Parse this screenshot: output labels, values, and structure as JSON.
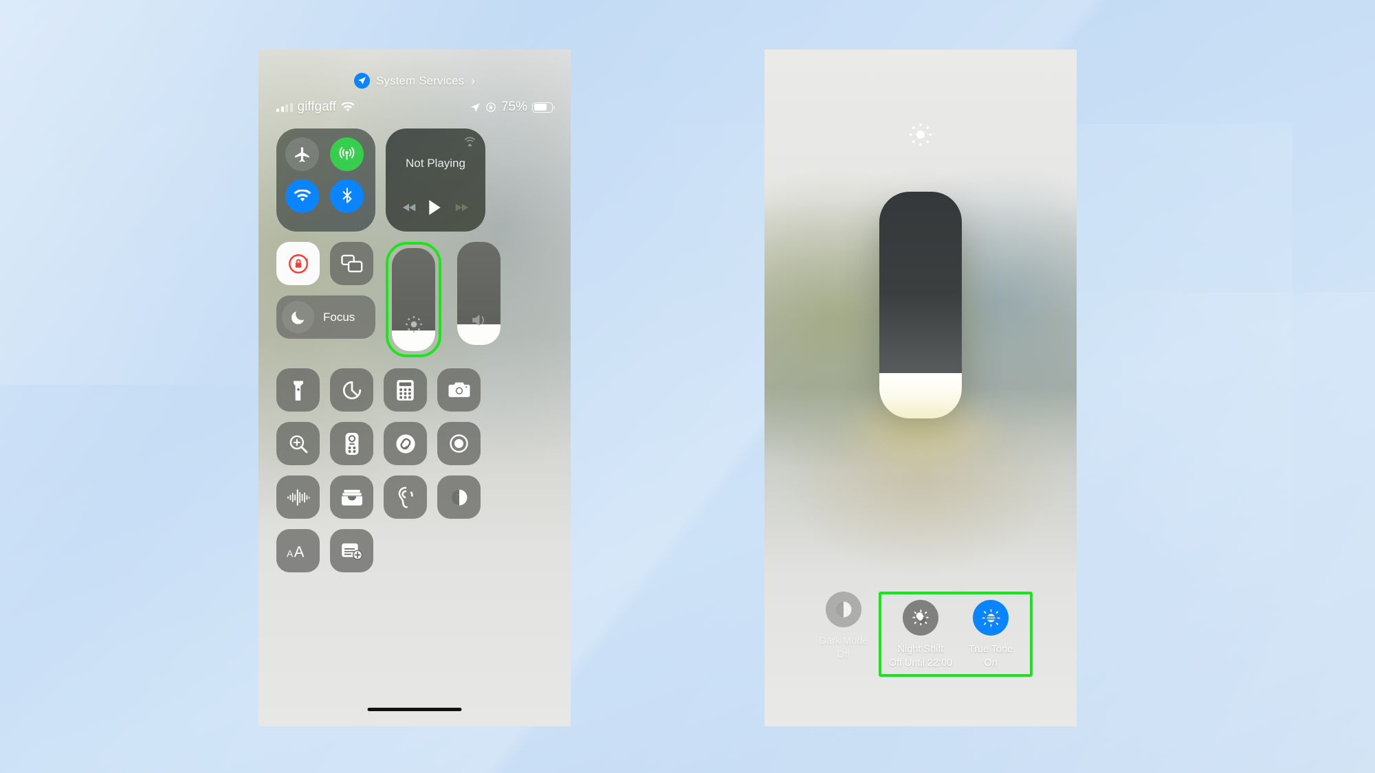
{
  "background": {
    "accent_blue": "#c6ddf5",
    "highlight_green": "#19e619"
  },
  "left_panel": {
    "system_services": {
      "label": "System Services",
      "chevron": "›",
      "icon": "location-arrow-icon"
    },
    "status_bar": {
      "carrier": "giffgaff",
      "wifi_icon": "wifi-icon",
      "location_icon": "location-arrow-icon",
      "rotation_lock_icon": "rotation-lock-icon",
      "battery_percent": "75%",
      "battery_level": 75
    },
    "connectivity": [
      {
        "name": "airplane-mode",
        "icon": "airplane-icon",
        "state": "off",
        "color": "#9aa09d"
      },
      {
        "name": "cellular-data",
        "icon": "cellular-icon",
        "state": "on",
        "color": "#37cd4d"
      },
      {
        "name": "wifi",
        "icon": "wifi-icon",
        "state": "on",
        "color": "#0a84ff"
      },
      {
        "name": "bluetooth",
        "icon": "bluetooth-icon",
        "state": "on",
        "color": "#0a84ff"
      }
    ],
    "media": {
      "title": "Not Playing",
      "airplay_icon": "airplay-icon",
      "prev_icon": "rewind-icon",
      "play_icon": "play-icon",
      "next_icon": "fast-forward-icon"
    },
    "tiles": [
      {
        "name": "rotation-lock",
        "icon": "rotation-lock-icon",
        "state": "on"
      },
      {
        "name": "screen-mirroring",
        "icon": "screen-mirroring-icon",
        "state": "off"
      }
    ],
    "focus": {
      "label": "Focus",
      "icon": "moon-icon"
    },
    "brightness_slider": {
      "name": "brightness-slider",
      "value": 20,
      "icon": "brightness-icon",
      "highlighted": true
    },
    "volume_slider": {
      "name": "volume-slider",
      "value": 20,
      "icon": "speaker-icon",
      "highlighted": false
    },
    "app_grid": [
      {
        "name": "flashlight",
        "icon": "flashlight-icon"
      },
      {
        "name": "timer",
        "icon": "timer-icon"
      },
      {
        "name": "calculator",
        "icon": "calculator-icon"
      },
      {
        "name": "camera",
        "icon": "camera-icon"
      },
      {
        "name": "magnifier",
        "icon": "magnifier-icon"
      },
      {
        "name": "apple-tv-remote",
        "icon": "remote-icon"
      },
      {
        "name": "shazam",
        "icon": "shazam-icon"
      },
      {
        "name": "screen-recording",
        "icon": "record-icon"
      },
      {
        "name": "voice-memos",
        "icon": "waveform-icon"
      },
      {
        "name": "wallet",
        "icon": "wallet-icon"
      },
      {
        "name": "hearing",
        "icon": "ear-icon"
      },
      {
        "name": "dark-mode",
        "icon": "dark-mode-icon"
      },
      {
        "name": "text-size",
        "icon": "text-size-icon"
      },
      {
        "name": "quick-note",
        "icon": "quick-note-icon"
      }
    ]
  },
  "right_panel": {
    "brightness": {
      "name": "brightness-slider-expanded",
      "value": 20,
      "icon": "brightness-icon",
      "fill_color": "#fdfbef"
    },
    "options": [
      {
        "name": "dark-mode",
        "icon": "dark-mode-icon",
        "label": "Dark Mode",
        "sub": "Off",
        "active": false,
        "highlighted": false
      },
      {
        "name": "night-shift",
        "icon": "night-shift-icon",
        "label": "Night Shift",
        "sub": "Off Until 22:00",
        "active": false,
        "highlighted": true
      },
      {
        "name": "true-tone",
        "icon": "true-tone-icon",
        "label": "True Tone",
        "sub": "On",
        "active": true,
        "highlighted": true
      }
    ]
  }
}
